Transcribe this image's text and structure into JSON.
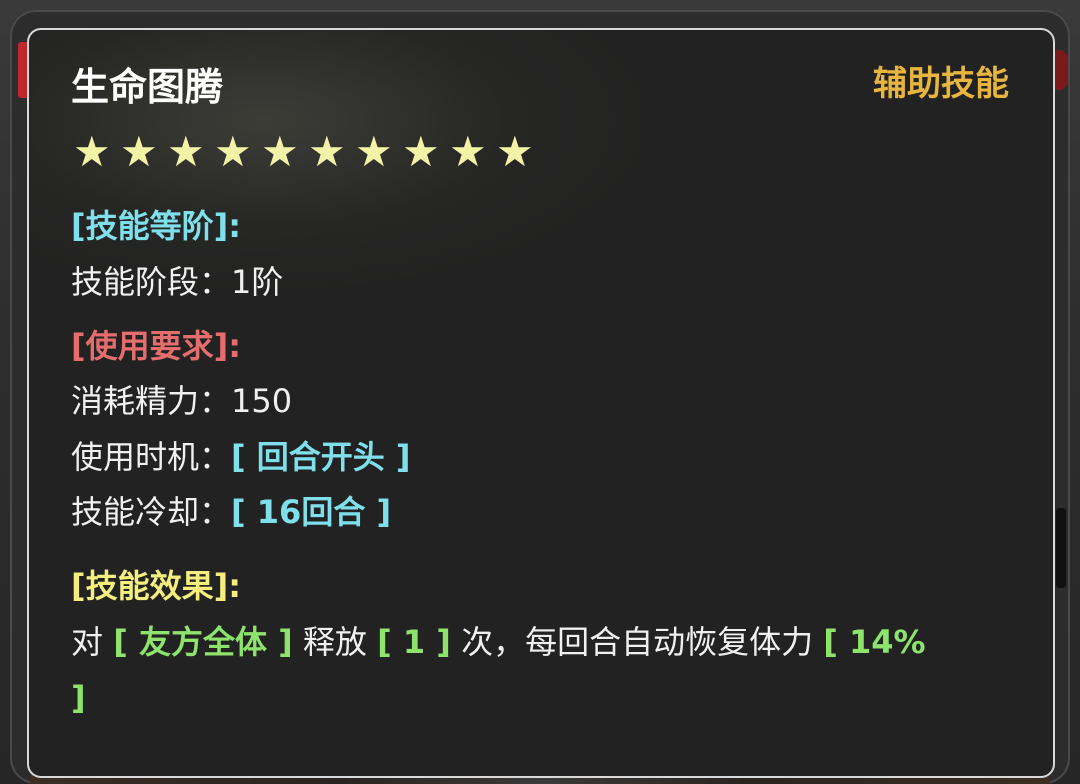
{
  "skill": {
    "name": "生命图腾",
    "type": "辅助技能",
    "star_count": 10,
    "star_glyph": "★",
    "colors": {
      "title": "#ffffff",
      "type": "#e8b53e",
      "star": "#f2f3a6",
      "section_level": "#7fe0ec",
      "section_requirement": "#e66d6d",
      "section_effect": "#f3ee7d",
      "value_cyan": "#7fe0ec",
      "value_green": "#8de36b"
    }
  },
  "sections": {
    "level": {
      "header": "[技能等阶]:",
      "stage_label": "技能阶段：",
      "stage_value": "1阶"
    },
    "requirement": {
      "header": "[使用要求]:",
      "energy_label": "消耗精力：",
      "energy_value": "150",
      "timing_label": "使用时机：",
      "timing_value": "[ 回合开头 ]",
      "cooldown_label": "技能冷却：",
      "cooldown_value": "[ 16回合 ]"
    },
    "effect": {
      "header": "[技能效果]:",
      "prefix": "对 ",
      "target": "[ 友方全体 ]",
      "release_text": " 释放 ",
      "times": "[ 1 ]",
      "mid_text": " 次，每回合自动恢复体力 ",
      "percent": "[ 14%",
      "close_bracket": "]"
    }
  }
}
